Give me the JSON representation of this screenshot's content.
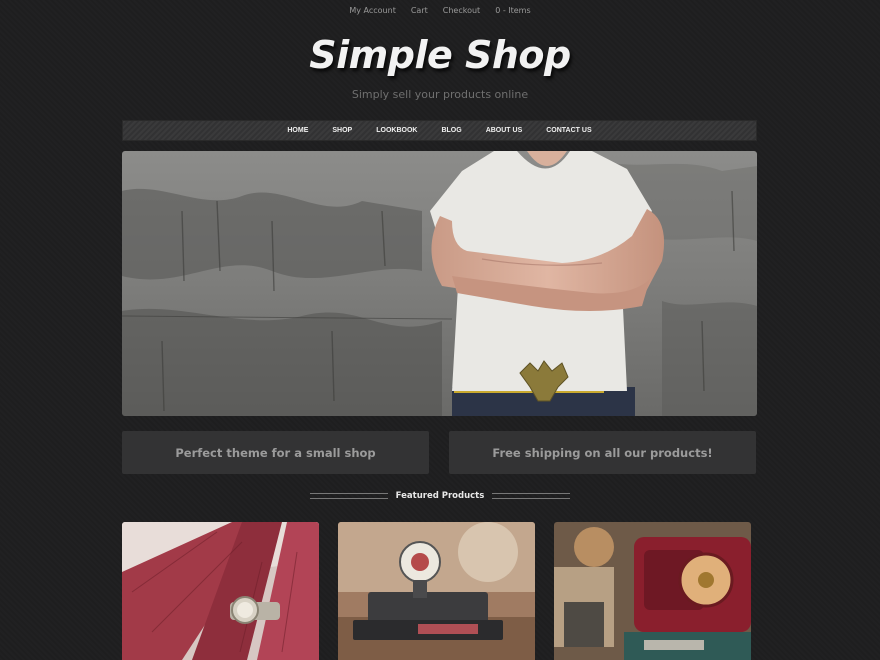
{
  "top_links": [
    "My Account",
    "Cart",
    "Checkout",
    "0 - Items"
  ],
  "site": {
    "title": "Simple Shop",
    "tagline": "Simply sell your products online"
  },
  "nav": [
    "HOME",
    "SHOP",
    "LOOKBOOK",
    "BLOG",
    "ABOUT US",
    "CONTACT US"
  ],
  "promos": [
    "Perfect theme for a small shop",
    "Free shipping on all our products!"
  ],
  "featured_heading": "Featured Products",
  "products": [
    {
      "image": "wristwatch-on-red-bench"
    },
    {
      "image": "vintage-label-maker"
    },
    {
      "image": "red-vintage-radio"
    }
  ],
  "colors": {
    "background": "#1e1e1f",
    "nav_bar": "#343435",
    "promo_box": "#333334",
    "promo_text": "#9b9b9b"
  }
}
